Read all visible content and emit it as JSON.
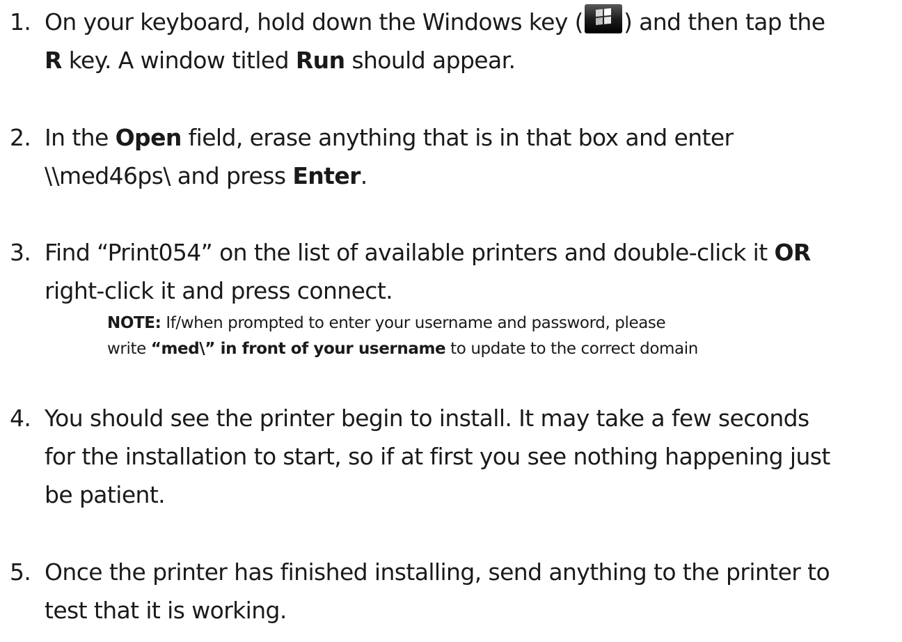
{
  "steps": [
    {
      "number": "1.",
      "l1_a": "On your keyboard, hold down the Windows key (",
      "windows_key_icon": "windows-logo-key",
      "l1_b": ") and then tap the",
      "l2_a": "R",
      "l2_b": " key. A window titled ",
      "l2_c": "Run",
      "l2_d": " should appear."
    },
    {
      "number": "2.",
      "l1_a": "In the ",
      "l1_b": "Open",
      "l1_c": " field, erase anything that is in that box and enter",
      "l2_a": "\\\\med46ps\\ and press ",
      "l2_b": "Enter",
      "l2_c": "."
    },
    {
      "number": "3.",
      "l1_a": "Find “Print054” on the list of available printers and double-click it ",
      "l1_b": "OR",
      "l2": "right-click it and press connect.",
      "note": {
        "l1_a": "NOTE:",
        "l1_b": " If/when prompted to enter your username and password, please",
        "l2_a": "write ",
        "l2_b": "“med\\” in front of your username",
        "l2_c": " to update to the correct domain"
      }
    },
    {
      "number": "4.",
      "l1": "You should see the printer begin to install. It may take a few seconds",
      "l2": "for the installation to start, so if at first you see nothing happening just",
      "l3": "be patient."
    },
    {
      "number": "5.",
      "l1": "Once the printer has finished installing, send anything to the printer to",
      "l2": "test that it is working."
    }
  ]
}
